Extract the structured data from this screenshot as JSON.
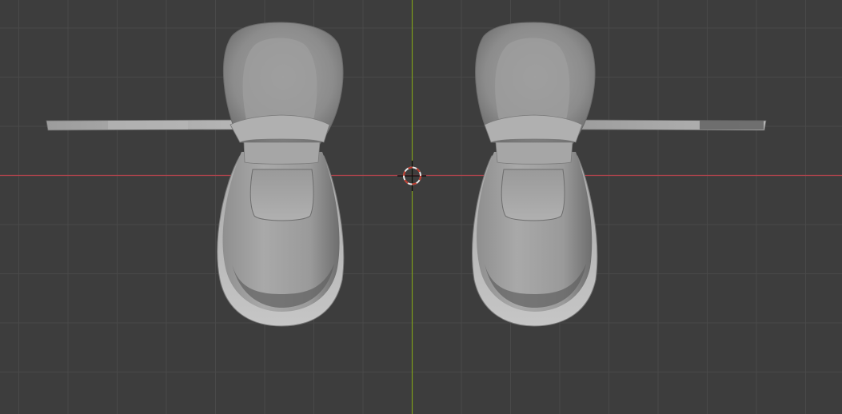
{
  "viewport": {
    "background": "#3d3d3d",
    "grid_color": "#494949",
    "x_axis_color": "#b2444d",
    "y_axis_color": "#7c9c1c"
  },
  "objects": [
    {
      "name": "left-shoe-mesh",
      "type": "mesh"
    },
    {
      "name": "right-shoe-mesh",
      "type": "mesh"
    }
  ],
  "cursor": {
    "name": "3d-cursor",
    "colors": [
      "#e8e8e8",
      "#c0392b"
    ]
  }
}
